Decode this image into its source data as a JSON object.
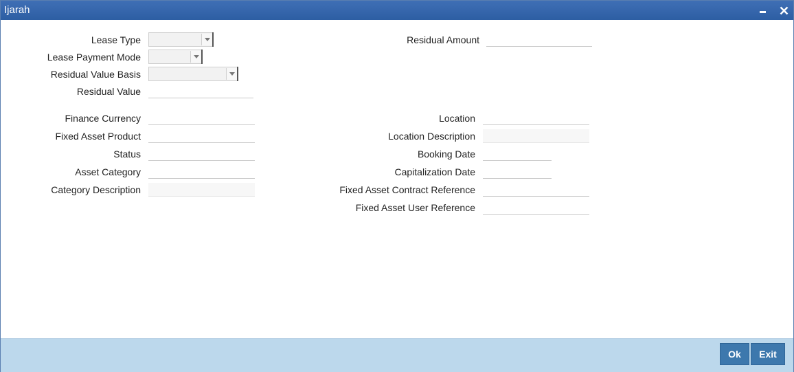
{
  "window": {
    "title": "Ijarah"
  },
  "titlebar": {
    "minimize_icon": "minimize-icon",
    "close_icon": "close-icon"
  },
  "left_fields": {
    "lease_type": {
      "label": "Lease Type",
      "value": ""
    },
    "lease_payment_mode": {
      "label": "Lease Payment Mode",
      "value": ""
    },
    "residual_value_basis": {
      "label": "Residual Value Basis",
      "value": ""
    },
    "residual_value": {
      "label": "Residual Value",
      "value": ""
    },
    "finance_currency": {
      "label": "Finance Currency",
      "value": ""
    },
    "fixed_asset_product": {
      "label": "Fixed Asset Product",
      "value": ""
    },
    "status": {
      "label": "Status",
      "value": ""
    },
    "asset_category": {
      "label": "Asset Category",
      "value": ""
    },
    "category_description": {
      "label": "Category Description",
      "value": ""
    }
  },
  "right_fields": {
    "residual_amount": {
      "label": "Residual Amount",
      "value": ""
    },
    "location": {
      "label": "Location",
      "value": ""
    },
    "location_description": {
      "label": "Location Description",
      "value": ""
    },
    "booking_date": {
      "label": "Booking Date",
      "value": ""
    },
    "capitalization_date": {
      "label": "Capitalization Date",
      "value": ""
    },
    "fixed_asset_contract_reference": {
      "label": "Fixed Asset Contract Reference",
      "value": ""
    },
    "fixed_asset_user_reference": {
      "label": "Fixed Asset User Reference",
      "value": ""
    }
  },
  "footer": {
    "ok_label": "Ok",
    "exit_label": "Exit"
  },
  "colors": {
    "titlebar": "#2d5ea3",
    "footer": "#bcd8ec",
    "button": "#3d78ad"
  }
}
